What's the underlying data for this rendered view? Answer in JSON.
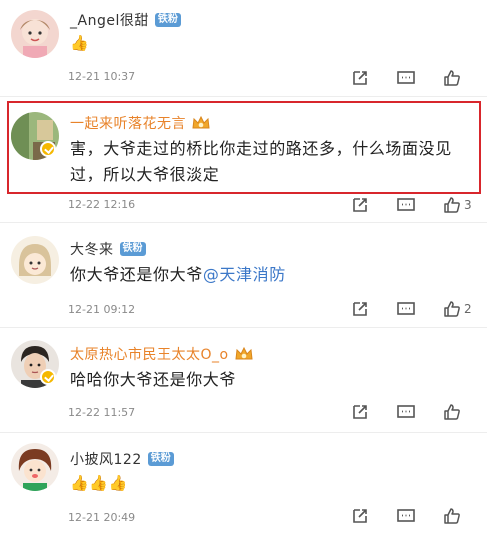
{
  "comments": [
    {
      "username": "_Angel很甜",
      "badge": "铁粉",
      "content": "👍",
      "time": "12-21 10:37",
      "likes": ""
    },
    {
      "username": "一起来听落花无言",
      "badge": "",
      "content": "害，大爷走过的桥比你走过的路还多，什么场面没见过，所以大爷很淡定",
      "time": "12-22 12:16",
      "likes": "3"
    },
    {
      "username": "大冬来",
      "badge": "铁粉",
      "content_prefix": "你大爷还是你大爷",
      "mention": "@天津消防",
      "time": "12-21 09:12",
      "likes": "2"
    },
    {
      "username": "太原热心市民王太太O_o",
      "badge": "",
      "content": "哈哈你大爷还是你大爷",
      "time": "12-22 11:57",
      "likes": ""
    },
    {
      "username": "小披风122",
      "badge": "铁粉",
      "content": "👍👍👍",
      "time": "12-21 20:49",
      "likes": ""
    }
  ],
  "colors": {
    "highlight": "#d8262c",
    "vip_name": "#e8832a",
    "badge": "#5b9bd5",
    "mention": "#3c78c8"
  }
}
